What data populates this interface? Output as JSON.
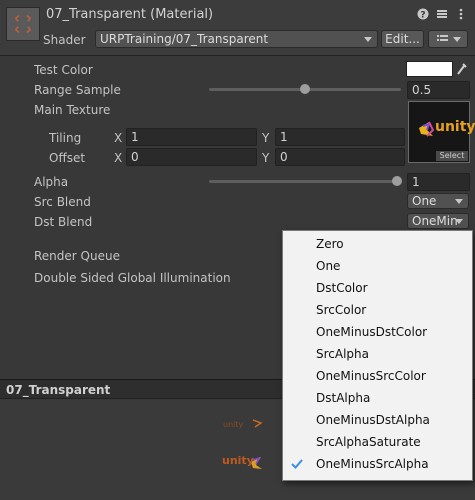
{
  "header": {
    "title": "07_Transparent (Material)",
    "shader_label": "Shader",
    "shader_value": "URPTraining/07_Transparent",
    "edit_label": "Edit...",
    "icons": [
      "help-icon",
      "preset-icon",
      "more-icon"
    ]
  },
  "properties": {
    "test_color": {
      "label": "Test Color",
      "value": "#ffffff"
    },
    "range_sample": {
      "label": "Range Sample",
      "value": "0.5",
      "slider": 0.5
    },
    "main_texture": {
      "label": "Main Texture",
      "texture_text": "unity",
      "select_label": "Select",
      "tiling": {
        "label": "Tiling",
        "x_label": "X",
        "x": "1",
        "y_label": "Y",
        "y": "1"
      },
      "offset": {
        "label": "Offset",
        "x_label": "X",
        "x": "0",
        "y_label": "Y",
        "y": "0"
      }
    },
    "alpha": {
      "label": "Alpha",
      "value": "1",
      "slider": 1.0
    },
    "src_blend": {
      "label": "Src Blend",
      "value": "One"
    },
    "dst_blend": {
      "label": "Dst Blend",
      "value": "OneMin"
    },
    "render_queue": {
      "label": "Render Queue"
    },
    "double_sided_gi": {
      "label": "Double Sided Global Illumination"
    }
  },
  "preview": {
    "title": "07_Transparent",
    "preview_text": "unity"
  },
  "menu": {
    "items": [
      {
        "label": "Zero",
        "checked": false
      },
      {
        "label": "One",
        "checked": false
      },
      {
        "label": "DstColor",
        "checked": false
      },
      {
        "label": "SrcColor",
        "checked": false
      },
      {
        "label": "OneMinusDstColor",
        "checked": false
      },
      {
        "label": "SrcAlpha",
        "checked": false
      },
      {
        "label": "OneMinusSrcColor",
        "checked": false
      },
      {
        "label": "DstAlpha",
        "checked": false
      },
      {
        "label": "OneMinusDstAlpha",
        "checked": false
      },
      {
        "label": "SrcAlphaSaturate",
        "checked": false
      },
      {
        "label": "OneMinusSrcAlpha",
        "checked": true
      }
    ],
    "check_color": "#3a8ee6"
  }
}
